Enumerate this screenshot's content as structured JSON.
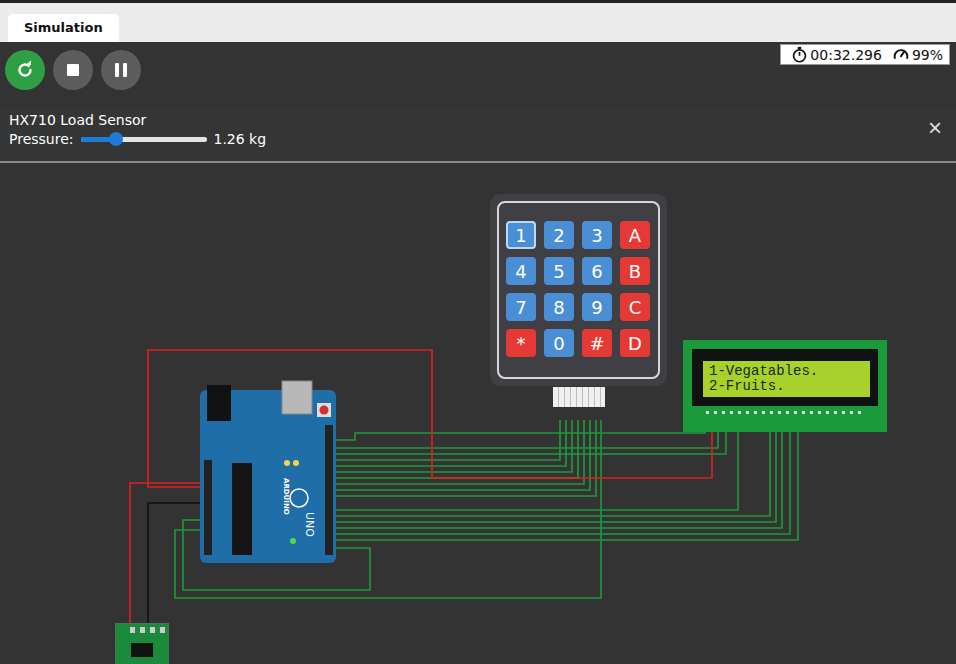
{
  "tabs": [
    {
      "label": "Simulation",
      "selected": true
    }
  ],
  "toolbar": {
    "buttons": [
      {
        "kind": "restart",
        "color": "#2ea043"
      },
      {
        "kind": "stop",
        "color": "#5c5c5c"
      },
      {
        "kind": "pause",
        "color": "#5c5c5c"
      }
    ]
  },
  "status": {
    "elapsed": "00:32.296",
    "speed": "99%"
  },
  "sensor_panel": {
    "title": "HX710 Load Sensor",
    "label": "Pressure:",
    "level": 0.28,
    "reading": "1.26 kg",
    "close": "×"
  },
  "keypad": {
    "keys": [
      {
        "label": "1",
        "color": "#4a8fd6",
        "pressed": true
      },
      {
        "label": "2",
        "color": "#4a8fd6",
        "pressed": false
      },
      {
        "label": "3",
        "color": "#4a8fd6",
        "pressed": false
      },
      {
        "label": "A",
        "color": "#e53935",
        "pressed": false
      },
      {
        "label": "4",
        "color": "#4a8fd6",
        "pressed": false
      },
      {
        "label": "5",
        "color": "#4a8fd6",
        "pressed": false
      },
      {
        "label": "6",
        "color": "#4a8fd6",
        "pressed": false
      },
      {
        "label": "B",
        "color": "#e53935",
        "pressed": false
      },
      {
        "label": "7",
        "color": "#4a8fd6",
        "pressed": false
      },
      {
        "label": "8",
        "color": "#4a8fd6",
        "pressed": false
      },
      {
        "label": "9",
        "color": "#4a8fd6",
        "pressed": false
      },
      {
        "label": "C",
        "color": "#e53935",
        "pressed": false
      },
      {
        "label": "*",
        "color": "#e53935",
        "pressed": false
      },
      {
        "label": "0",
        "color": "#4a8fd6",
        "pressed": false
      },
      {
        "label": "#",
        "color": "#e53935",
        "pressed": false
      },
      {
        "label": "D",
        "color": "#e53935",
        "pressed": false
      }
    ]
  },
  "lcd": {
    "lines": [
      "1-Vegatables.",
      "2-Fruits."
    ]
  },
  "arduino": {
    "brand": "ARDUINO",
    "model": "UNO",
    "power_led_on": true
  }
}
